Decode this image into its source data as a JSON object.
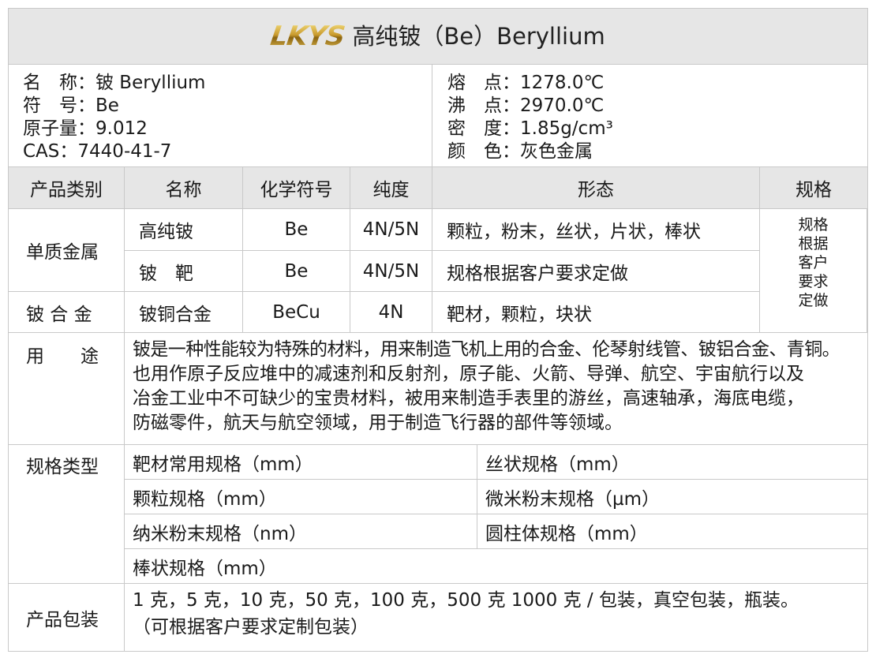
{
  "header": {
    "logo_text": "LKYS",
    "title": "高纯铍（Be）Beryllium"
  },
  "info": {
    "left": [
      {
        "key": "名　称：",
        "value": "铍 Beryllium"
      },
      {
        "key": "符　号：",
        "value": "Be"
      },
      {
        "key": "原子量：",
        "value": "9.012"
      },
      {
        "key": "CAS：",
        "value": "7440-41-7"
      }
    ],
    "right": [
      {
        "key": "熔　点：",
        "value": "1278.0℃"
      },
      {
        "key": "沸　点：",
        "value": "2970.0℃"
      },
      {
        "key": "密　度：",
        "value": "1.85g/cm³"
      },
      {
        "key": "颜　色：",
        "value": "灰色金属"
      }
    ]
  },
  "table": {
    "headers": [
      "产品类别",
      "名称",
      "化学符号",
      "纯度",
      "形态",
      "规格"
    ],
    "groups": [
      {
        "category": "单质金属"
      },
      {
        "category": "铍 合 金"
      }
    ],
    "rows": [
      {
        "name": "高纯铍",
        "symbol": "Be",
        "purity": "4N/5N",
        "form": "颗粒，粉末，丝状，片状，棒状"
      },
      {
        "name": "铍　靶",
        "symbol": "Be",
        "purity": "4N/5N",
        "form": "规格根据客户要求定做"
      },
      {
        "name": "铍铜合金",
        "symbol": "BeCu",
        "purity": "4N",
        "form": "靶材，颗粒，块状"
      }
    ],
    "spec_note": [
      "规格",
      "根据",
      "客户",
      "要求",
      "定做"
    ]
  },
  "usage": {
    "label": "用　　途",
    "lines": [
      "铍是一种性能较为特殊的材料，用来制造飞机上用的合金、伦琴射线管、铍铝合金、青铜。",
      "也用作原子反应堆中的减速剂和反射剂，原子能、火箭、导弹、航空、宇宙航行以及",
      "冶金工业中不可缺少的宝贵材料，被用来制造手表里的游丝，高速轴承，海底电缆，",
      "防磁零件，航天与航空领域，用于制造飞行器的部件等领域。"
    ]
  },
  "spec_types": {
    "label": "规格类型",
    "items": [
      "靶材常用规格（mm）",
      "丝状规格（mm）",
      "颗粒规格（mm）",
      "微米粉末规格（µm）",
      "纳米粉末规格（nm）",
      "圆柱体规格（mm）",
      "棒状规格（mm）"
    ]
  },
  "packaging": {
    "label": "产品包装",
    "lines": [
      "1 克，5 克，10 克，50 克，100 克，500 克 1000 克 / 包装，真空包装，瓶装。",
      "（可根据客户要求定制包装）"
    ]
  }
}
